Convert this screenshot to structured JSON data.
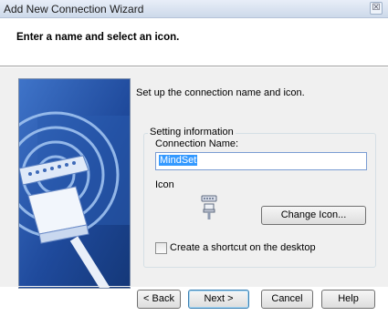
{
  "window": {
    "title": "Add New Connection Wizard",
    "close_glyph": "☒"
  },
  "header": {
    "title": "Enter a name and select an icon."
  },
  "intro": "Set up the connection name and icon.",
  "group": {
    "legend": "Setting information",
    "connection_name_label": "Connection Name:",
    "connection_name_value": "MindSet",
    "icon_label": "Icon",
    "icon": "serial-port-connection-icon",
    "change_icon_label": "Change Icon...",
    "shortcut_label": "Create a shortcut on the desktop",
    "shortcut_checked": false
  },
  "buttons": {
    "back": "< Back",
    "next": "Next >",
    "cancel": "Cancel",
    "help": "Help"
  },
  "colors": {
    "art_blue": "#1f4a9c",
    "selection": "#3399ff"
  }
}
